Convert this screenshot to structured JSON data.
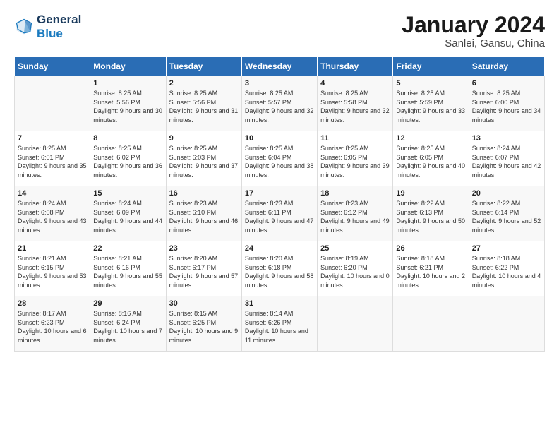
{
  "header": {
    "logo_line1": "General",
    "logo_line2": "Blue",
    "title": "January 2024",
    "subtitle": "Sanlei, Gansu, China"
  },
  "columns": [
    "Sunday",
    "Monday",
    "Tuesday",
    "Wednesday",
    "Thursday",
    "Friday",
    "Saturday"
  ],
  "weeks": [
    [
      {
        "day": "",
        "sunrise": "",
        "sunset": "",
        "daylight": ""
      },
      {
        "day": "1",
        "sunrise": "Sunrise: 8:25 AM",
        "sunset": "Sunset: 5:56 PM",
        "daylight": "Daylight: 9 hours and 30 minutes."
      },
      {
        "day": "2",
        "sunrise": "Sunrise: 8:25 AM",
        "sunset": "Sunset: 5:56 PM",
        "daylight": "Daylight: 9 hours and 31 minutes."
      },
      {
        "day": "3",
        "sunrise": "Sunrise: 8:25 AM",
        "sunset": "Sunset: 5:57 PM",
        "daylight": "Daylight: 9 hours and 32 minutes."
      },
      {
        "day": "4",
        "sunrise": "Sunrise: 8:25 AM",
        "sunset": "Sunset: 5:58 PM",
        "daylight": "Daylight: 9 hours and 32 minutes."
      },
      {
        "day": "5",
        "sunrise": "Sunrise: 8:25 AM",
        "sunset": "Sunset: 5:59 PM",
        "daylight": "Daylight: 9 hours and 33 minutes."
      },
      {
        "day": "6",
        "sunrise": "Sunrise: 8:25 AM",
        "sunset": "Sunset: 6:00 PM",
        "daylight": "Daylight: 9 hours and 34 minutes."
      }
    ],
    [
      {
        "day": "7",
        "sunrise": "Sunrise: 8:25 AM",
        "sunset": "Sunset: 6:01 PM",
        "daylight": "Daylight: 9 hours and 35 minutes."
      },
      {
        "day": "8",
        "sunrise": "Sunrise: 8:25 AM",
        "sunset": "Sunset: 6:02 PM",
        "daylight": "Daylight: 9 hours and 36 minutes."
      },
      {
        "day": "9",
        "sunrise": "Sunrise: 8:25 AM",
        "sunset": "Sunset: 6:03 PM",
        "daylight": "Daylight: 9 hours and 37 minutes."
      },
      {
        "day": "10",
        "sunrise": "Sunrise: 8:25 AM",
        "sunset": "Sunset: 6:04 PM",
        "daylight": "Daylight: 9 hours and 38 minutes."
      },
      {
        "day": "11",
        "sunrise": "Sunrise: 8:25 AM",
        "sunset": "Sunset: 6:05 PM",
        "daylight": "Daylight: 9 hours and 39 minutes."
      },
      {
        "day": "12",
        "sunrise": "Sunrise: 8:25 AM",
        "sunset": "Sunset: 6:05 PM",
        "daylight": "Daylight: 9 hours and 40 minutes."
      },
      {
        "day": "13",
        "sunrise": "Sunrise: 8:24 AM",
        "sunset": "Sunset: 6:07 PM",
        "daylight": "Daylight: 9 hours and 42 minutes."
      }
    ],
    [
      {
        "day": "14",
        "sunrise": "Sunrise: 8:24 AM",
        "sunset": "Sunset: 6:08 PM",
        "daylight": "Daylight: 9 hours and 43 minutes."
      },
      {
        "day": "15",
        "sunrise": "Sunrise: 8:24 AM",
        "sunset": "Sunset: 6:09 PM",
        "daylight": "Daylight: 9 hours and 44 minutes."
      },
      {
        "day": "16",
        "sunrise": "Sunrise: 8:23 AM",
        "sunset": "Sunset: 6:10 PM",
        "daylight": "Daylight: 9 hours and 46 minutes."
      },
      {
        "day": "17",
        "sunrise": "Sunrise: 8:23 AM",
        "sunset": "Sunset: 6:11 PM",
        "daylight": "Daylight: 9 hours and 47 minutes."
      },
      {
        "day": "18",
        "sunrise": "Sunrise: 8:23 AM",
        "sunset": "Sunset: 6:12 PM",
        "daylight": "Daylight: 9 hours and 49 minutes."
      },
      {
        "day": "19",
        "sunrise": "Sunrise: 8:22 AM",
        "sunset": "Sunset: 6:13 PM",
        "daylight": "Daylight: 9 hours and 50 minutes."
      },
      {
        "day": "20",
        "sunrise": "Sunrise: 8:22 AM",
        "sunset": "Sunset: 6:14 PM",
        "daylight": "Daylight: 9 hours and 52 minutes."
      }
    ],
    [
      {
        "day": "21",
        "sunrise": "Sunrise: 8:21 AM",
        "sunset": "Sunset: 6:15 PM",
        "daylight": "Daylight: 9 hours and 53 minutes."
      },
      {
        "day": "22",
        "sunrise": "Sunrise: 8:21 AM",
        "sunset": "Sunset: 6:16 PM",
        "daylight": "Daylight: 9 hours and 55 minutes."
      },
      {
        "day": "23",
        "sunrise": "Sunrise: 8:20 AM",
        "sunset": "Sunset: 6:17 PM",
        "daylight": "Daylight: 9 hours and 57 minutes."
      },
      {
        "day": "24",
        "sunrise": "Sunrise: 8:20 AM",
        "sunset": "Sunset: 6:18 PM",
        "daylight": "Daylight: 9 hours and 58 minutes."
      },
      {
        "day": "25",
        "sunrise": "Sunrise: 8:19 AM",
        "sunset": "Sunset: 6:20 PM",
        "daylight": "Daylight: 10 hours and 0 minutes."
      },
      {
        "day": "26",
        "sunrise": "Sunrise: 8:18 AM",
        "sunset": "Sunset: 6:21 PM",
        "daylight": "Daylight: 10 hours and 2 minutes."
      },
      {
        "day": "27",
        "sunrise": "Sunrise: 8:18 AM",
        "sunset": "Sunset: 6:22 PM",
        "daylight": "Daylight: 10 hours and 4 minutes."
      }
    ],
    [
      {
        "day": "28",
        "sunrise": "Sunrise: 8:17 AM",
        "sunset": "Sunset: 6:23 PM",
        "daylight": "Daylight: 10 hours and 6 minutes."
      },
      {
        "day": "29",
        "sunrise": "Sunrise: 8:16 AM",
        "sunset": "Sunset: 6:24 PM",
        "daylight": "Daylight: 10 hours and 7 minutes."
      },
      {
        "day": "30",
        "sunrise": "Sunrise: 8:15 AM",
        "sunset": "Sunset: 6:25 PM",
        "daylight": "Daylight: 10 hours and 9 minutes."
      },
      {
        "day": "31",
        "sunrise": "Sunrise: 8:14 AM",
        "sunset": "Sunset: 6:26 PM",
        "daylight": "Daylight: 10 hours and 11 minutes."
      },
      {
        "day": "",
        "sunrise": "",
        "sunset": "",
        "daylight": ""
      },
      {
        "day": "",
        "sunrise": "",
        "sunset": "",
        "daylight": ""
      },
      {
        "day": "",
        "sunrise": "",
        "sunset": "",
        "daylight": ""
      }
    ]
  ]
}
